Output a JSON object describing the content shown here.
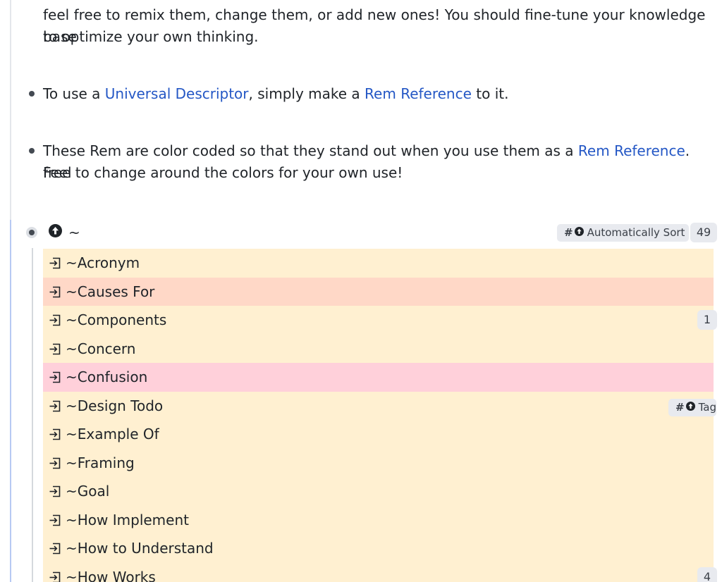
{
  "paragraphs": {
    "intro_line1": "feel free to remix them, change them, or add new ones! You should fine-tune your knowledge base",
    "intro_line2": "to optimize your own thinking.",
    "bullet1": {
      "text_before": "To use a ",
      "link1": "Universal Descriptor",
      "text_middle": ", simply make a ",
      "link2": "Rem Reference",
      "text_after": " to it."
    },
    "bullet2": {
      "text_before": "These Rem are color coded so that they stand out when you use them as a ",
      "link": "Rem Reference",
      "text_after": ". Feel",
      "line2": "free to change around the colors for your own use!"
    }
  },
  "tree": {
    "root_label": "~",
    "root_tag": "Automatically Sort",
    "root_count": "49",
    "items": [
      {
        "label": "~Acronym",
        "color": "#fff0d1"
      },
      {
        "label": "~Causes For",
        "color": "#ffd8c7"
      },
      {
        "label": "~Components",
        "color": "#fff0d1",
        "count": "1"
      },
      {
        "label": "~Concern",
        "color": "#fff0d1"
      },
      {
        "label": "~Confusion",
        "color": "#ffd0da"
      },
      {
        "label": "~Design Todo",
        "color": "#fff0d1",
        "tag": "Tag"
      },
      {
        "label": "~Example Of",
        "color": "#fff0d1"
      },
      {
        "label": "~Framing",
        "color": "#fff0d1"
      },
      {
        "label": "~Goal",
        "color": "#fff0d1"
      },
      {
        "label": "~How Implement",
        "color": "#fff0d1"
      },
      {
        "label": "~How to Understand",
        "color": "#fff0d1"
      },
      {
        "label": "~How Works",
        "color": "#fff0d1",
        "count": "4"
      }
    ]
  },
  "icons": {
    "root_icon": "arrow-up-circle-icon",
    "row_icon": "reference-arrow-icon",
    "tag_icon": "arrow-up-circle-icon"
  },
  "colors": {
    "link": "#2457c5",
    "left_bar": "#b7c9f3",
    "chip_bg": "#e8eaef"
  }
}
